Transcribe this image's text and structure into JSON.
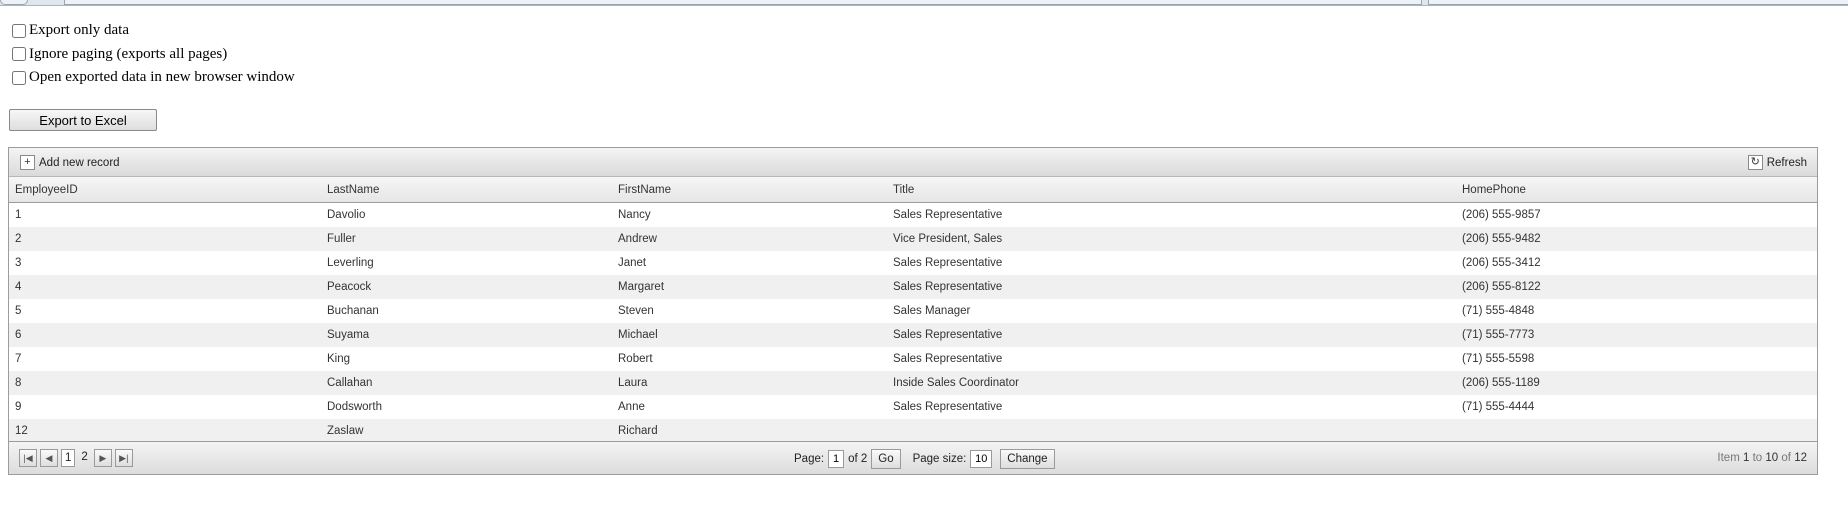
{
  "options": [
    {
      "label": "Export only data",
      "checked": false
    },
    {
      "label": "Ignore paging (exports all pages)",
      "checked": false
    },
    {
      "label": "Open exported data in new browser window",
      "checked": false
    }
  ],
  "export_button": "Export to Excel",
  "command_bar": {
    "add_label": "Add new record",
    "refresh_label": "Refresh"
  },
  "grid": {
    "columns": [
      "EmployeeID",
      "LastName",
      "FirstName",
      "Title",
      "HomePhone"
    ],
    "rows": [
      [
        "1",
        "Davolio",
        "Nancy",
        "Sales Representative",
        "(206) 555-9857"
      ],
      [
        "2",
        "Fuller",
        "Andrew",
        "Vice President, Sales",
        "(206) 555-9482"
      ],
      [
        "3",
        "Leverling",
        "Janet",
        "Sales Representative",
        "(206) 555-3412"
      ],
      [
        "4",
        "Peacock",
        "Margaret",
        "Sales Representative",
        "(206) 555-8122"
      ],
      [
        "5",
        "Buchanan",
        "Steven",
        "Sales Manager",
        "(71) 555-4848"
      ],
      [
        "6",
        "Suyama",
        "Michael",
        "Sales Representative",
        "(71) 555-7773"
      ],
      [
        "7",
        "King",
        "Robert",
        "Sales Representative",
        "(71) 555-5598"
      ],
      [
        "8",
        "Callahan",
        "Laura",
        "Inside Sales Coordinator",
        "(206) 555-1189"
      ],
      [
        "9",
        "Dodsworth",
        "Anne",
        "Sales Representative",
        "(71) 555-4444"
      ],
      [
        "12",
        "Zaslaw",
        "Richard",
        "",
        ""
      ]
    ]
  },
  "pager": {
    "pages": [
      "1",
      "2"
    ],
    "current_page": "1",
    "page_label": "Page:",
    "of_label": "of 2",
    "go_label": "Go",
    "page_size_label": "Page size:",
    "page_size": "10",
    "change_label": "Change",
    "info_item": "Item",
    "info_from": "1",
    "info_to_label": "to",
    "info_to": "10",
    "info_of_label": "of",
    "info_total": "12"
  }
}
